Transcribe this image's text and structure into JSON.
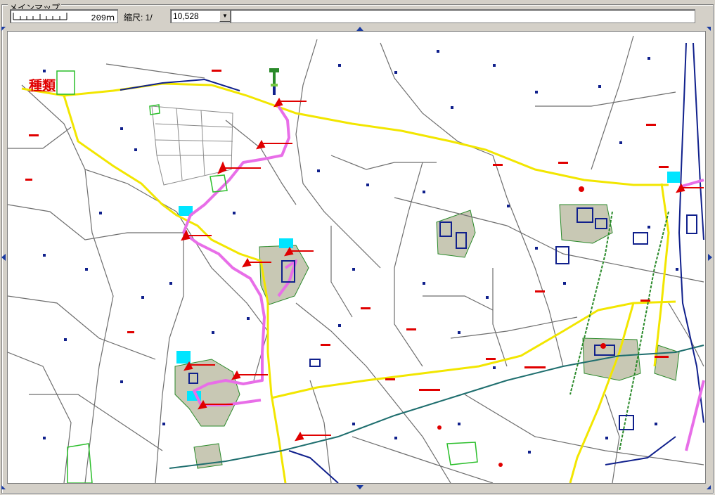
{
  "panel": {
    "title": "メインマップ"
  },
  "toolbar": {
    "scale_distance": "209ｍ",
    "scale_label": "縮尺: 1/",
    "scale_value": "10,528",
    "info_text": ""
  },
  "map": {
    "layer_title": "種類"
  },
  "colors": {
    "road_major": "#f2e600",
    "route": "#e86ee8",
    "rail": "#1e6e6e",
    "facility": "#c8c8b4",
    "water": "#00e5ff",
    "marker": "#e00000",
    "dot": "#10208c"
  }
}
